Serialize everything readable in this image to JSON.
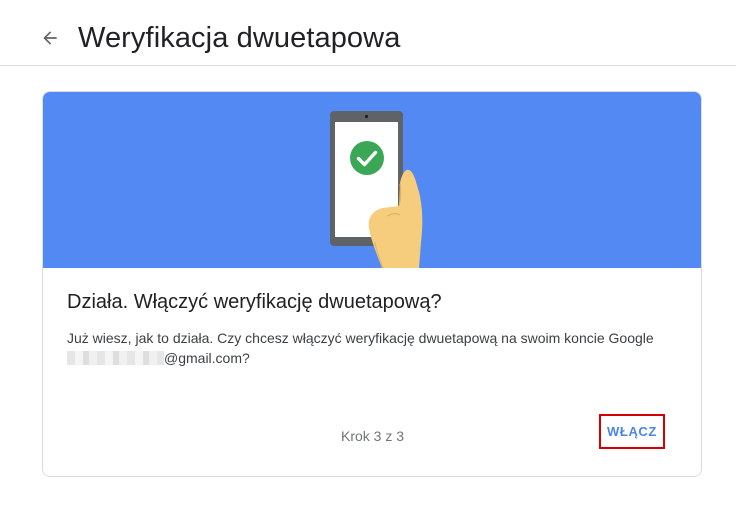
{
  "header": {
    "back_icon": "arrow-back-icon",
    "title": "Weryfikacja dwuetapowa"
  },
  "card": {
    "banner_color": "#5389f3",
    "illustration": "phone-check-icon",
    "heading": "Działa. Włączyć weryfikację dwuetapową?",
    "text_line1": "Już wiesz, jak to działa. Czy chcesz włączyć weryfikację dwuetapową na swoim koncie Google",
    "email_suffix": "@gmail.com?",
    "step": "Krok 3 z 3",
    "enable_label": "WŁĄCZ"
  },
  "colors": {
    "accent": "#4a86e8",
    "highlight_border": "#d50000",
    "check_green": "#3aa757"
  }
}
